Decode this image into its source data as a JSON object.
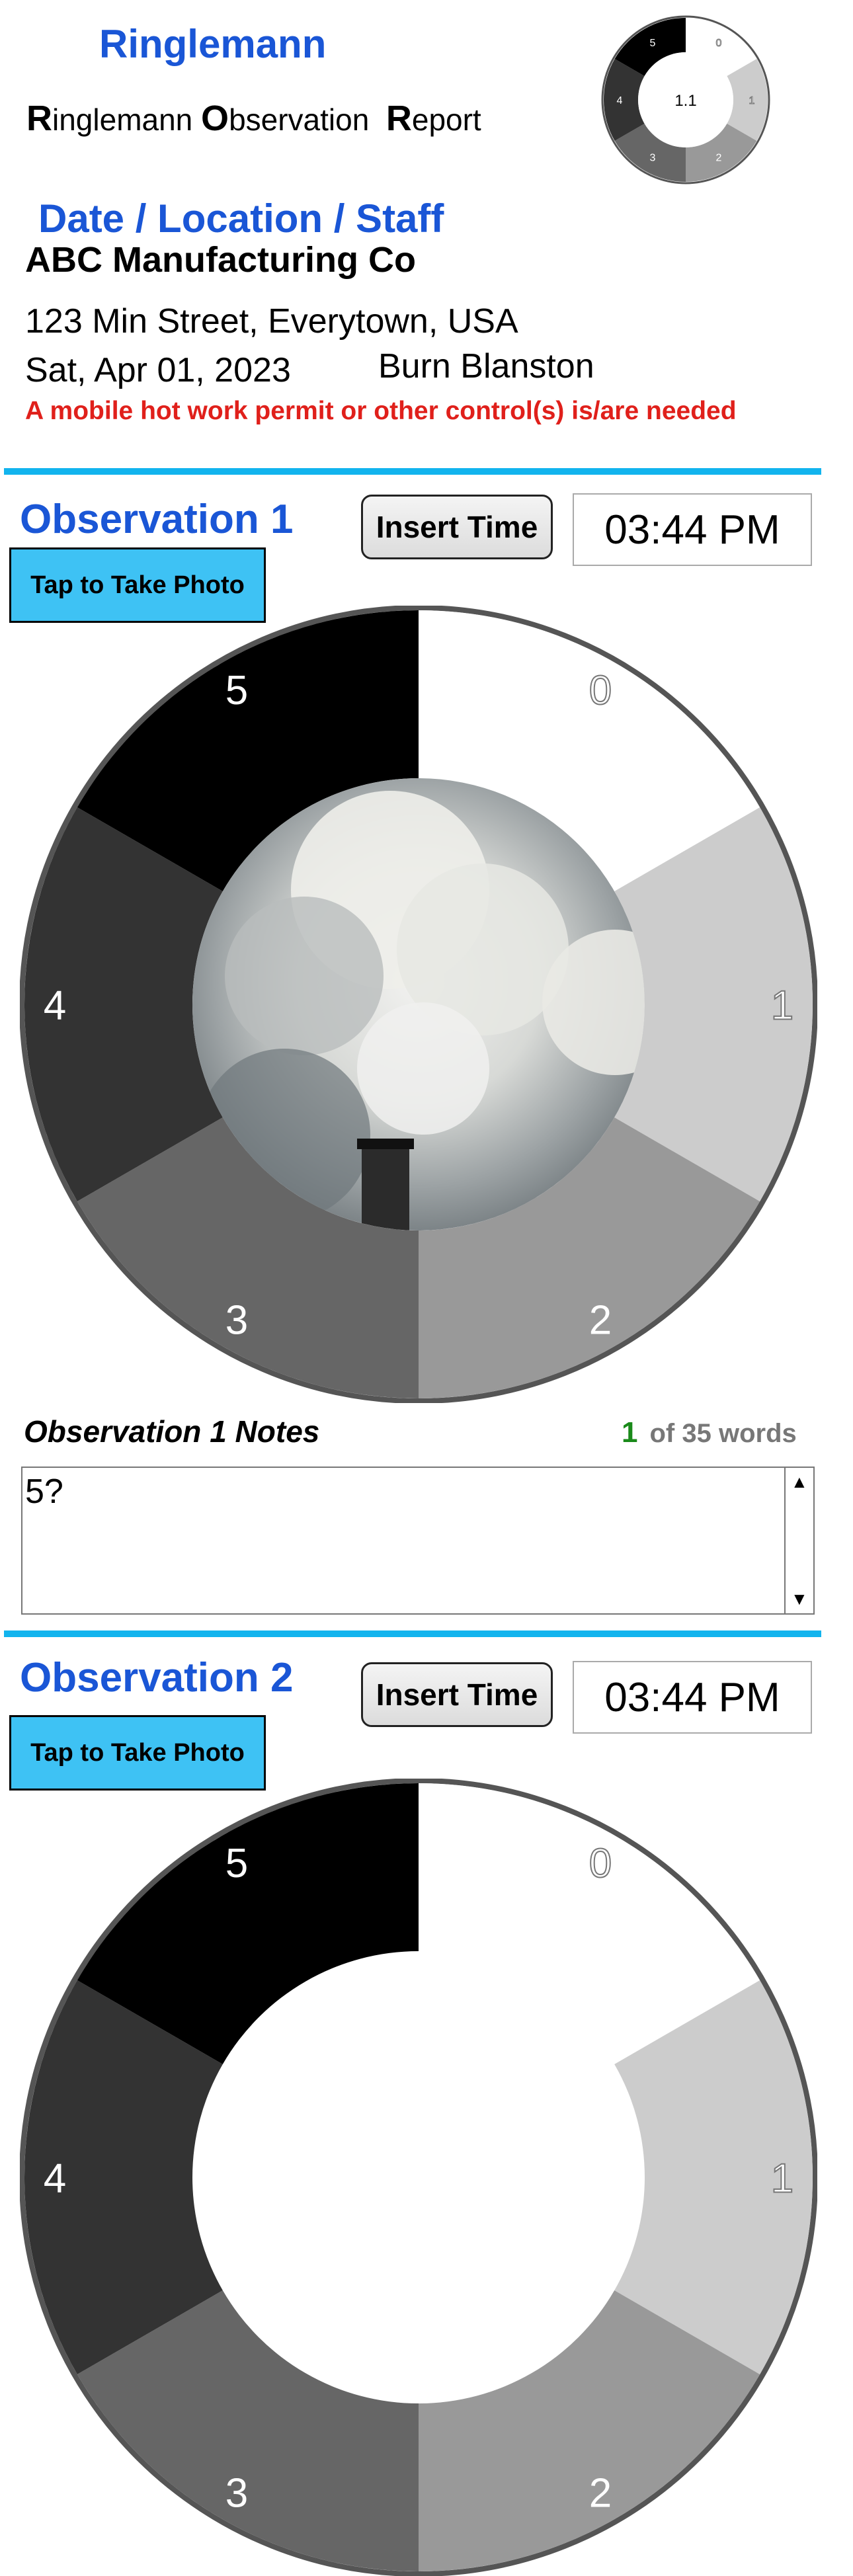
{
  "header": {
    "app_title": "Ringlemann",
    "report_title_parts": [
      {
        "initial": "R",
        "rest": "inglemann "
      },
      {
        "initial": "O",
        "rest": "bservation  "
      },
      {
        "initial": "R",
        "rest": "eport"
      }
    ],
    "mini_wheel": {
      "center_value": "1.1",
      "labels": [
        "0",
        "1",
        "2",
        "3",
        "4",
        "5"
      ]
    }
  },
  "info": {
    "section_title": "Date / Location / Staff",
    "company": "ABC Manufacturing Co",
    "address": "123 Min Street, Everytown, USA",
    "date": "Sat, Apr 01, 2023",
    "staff": "Burn Blanston",
    "warning": "A mobile hot work permit or other control(s) is/are needed"
  },
  "observations": [
    {
      "title": "Observation 1",
      "insert_time_label": "Insert Time",
      "time": "03:44 PM",
      "photo_button": "Tap to Take Photo",
      "wheel_labels": [
        "0",
        "1",
        "2",
        "3",
        "4",
        "5"
      ],
      "notes_label": "Observation 1 Notes",
      "word_count": "1",
      "word_limit": "of 35 words",
      "notes_text": "5?"
    },
    {
      "title": "Observation 2",
      "insert_time_label": "Insert Time",
      "time": "03:44 PM",
      "photo_button": "Tap to Take Photo",
      "wheel_labels": [
        "0",
        "1",
        "2",
        "3",
        "4",
        "5"
      ]
    }
  ],
  "colors": {
    "accent_blue": "#1a56d6",
    "divider": "#12b4ee",
    "button_blue": "#3ec2f4",
    "warning_red": "#e0201b",
    "shade_0": "#ffffff",
    "shade_1": "#cccccc",
    "shade_2": "#999999",
    "shade_3": "#666666",
    "shade_4": "#333333",
    "shade_5": "#000000"
  },
  "icons": {
    "scroll_up": "triangle-up-icon",
    "scroll_down": "triangle-down-icon"
  }
}
